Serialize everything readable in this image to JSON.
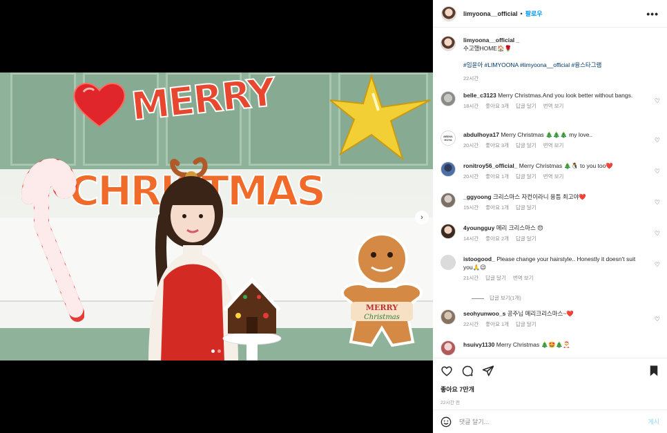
{
  "post": {
    "author": "limyoona__official",
    "follow_label": "팔로우",
    "more_label": "•••",
    "media_dots": 2,
    "active_dot": 0
  },
  "photo": {
    "balloon_text_1": "MERRY",
    "balloon_text_2": "CHRISTMAS",
    "ginger_text_1": "MERRY",
    "ginger_text_2": "Christmas"
  },
  "caption": {
    "user": "limyoona__official _",
    "text": "수고했HOME🏠🌹",
    "tags": "#임윤아 #LIMYOONA #limyoona__official #융스타그램",
    "time": "22시간"
  },
  "comments": [
    {
      "user": "belle_c3123",
      "text": "Merry Christmas.And you look better without bangs.",
      "time": "18시간",
      "likes": "좋아요 3개",
      "reply": "답글 달기",
      "translate": "번역 보기"
    },
    {
      "user": "abdulhoya17",
      "text": "Merry Christmas 🎄🎄🎄 my love..",
      "time": "20시간",
      "likes": "좋아요 3개",
      "reply": "답글 달기",
      "translate": "번역 보기",
      "avatar_text": "ABDUL HOYA"
    },
    {
      "user": "ronitroy56_official_",
      "text": "Merry Christmas 🎄🐧 to you too❤️",
      "time": "20시간",
      "likes": "좋아요 1개",
      "reply": "답글 달기",
      "translate": "번역 보기"
    },
    {
      "user": "_ggyoong",
      "text": "크리스마스 자컨이라니 융틈 최고야❤️",
      "time": "15시간",
      "likes": "좋아요 1개",
      "reply": "답글 달기"
    },
    {
      "user": "4youngguy",
      "text": "메리 크리스마스 😍",
      "time": "14시간",
      "likes": "좋아요 2개",
      "reply": "답글 달기"
    },
    {
      "user": "istoogood_",
      "text": "Please change your hairstyle.. Honestly it doesn't suit you🙏😉",
      "time": "21시간",
      "reply": "답글 달기",
      "translate": "번역 보기",
      "replies": "답글 보기(1개)"
    },
    {
      "user": "seohyunwoo_s",
      "text": "공주님 메리크리스마스~❤️",
      "time": "22시간",
      "likes": "좋아요 1개",
      "reply": "답글 달기"
    },
    {
      "user": "hsuivy1130",
      "text": "Merry Christmas 🎄🤩🎄🎅"
    }
  ],
  "actions": {
    "likes": "좋아요 7만개",
    "time_ago": "22시간 전"
  },
  "add_comment": {
    "placeholder": "댓글 달기...",
    "post_label": "게시"
  }
}
